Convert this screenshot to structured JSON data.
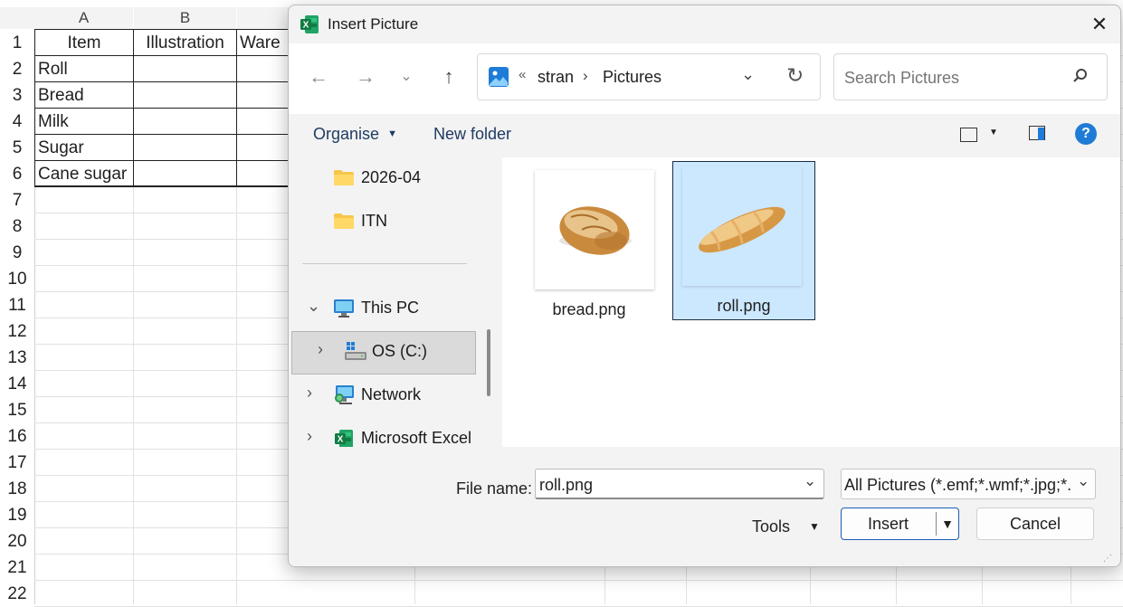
{
  "sheet": {
    "columns": [
      "A",
      "B"
    ],
    "rows": [
      "1",
      "2",
      "3",
      "4",
      "5",
      "6",
      "7",
      "8",
      "9",
      "10",
      "11",
      "12",
      "13",
      "14",
      "15",
      "16",
      "17",
      "18",
      "19",
      "20",
      "21",
      "22"
    ],
    "table": {
      "headers": [
        "Item",
        "Illustration",
        "Ware"
      ],
      "items": [
        "Roll",
        "Bread",
        "Milk",
        "Sugar",
        "Cane sugar"
      ]
    }
  },
  "dialog": {
    "title": "Insert Picture",
    "app_icon": "excel-icon",
    "address": {
      "overflow": "«",
      "crumbs": [
        "stran",
        "Pictures"
      ]
    },
    "search_placeholder": "Search Pictures",
    "toolbar": {
      "organise": "Organise",
      "new_folder": "New folder"
    },
    "nav": {
      "items": [
        {
          "label": "2026-04",
          "icon": "folder-icon"
        },
        {
          "label": "ITN",
          "icon": "folder-icon"
        },
        {
          "label": "This PC",
          "icon": "computer-icon"
        },
        {
          "label": "OS (C:)",
          "icon": "drive-icon"
        },
        {
          "label": "Network",
          "icon": "network-icon"
        },
        {
          "label": "Microsoft Excel",
          "icon": "excel-icon"
        }
      ]
    },
    "files": [
      {
        "name": "bread.png",
        "selected": false
      },
      {
        "name": "roll.png",
        "selected": true
      }
    ],
    "file_name_label": "File name:",
    "file_name_value": "roll.png",
    "file_type": "All Pictures (*.emf;*.wmf;*.jpg;*.",
    "tools_label": "Tools",
    "insert_label": "Insert",
    "cancel_label": "Cancel"
  }
}
